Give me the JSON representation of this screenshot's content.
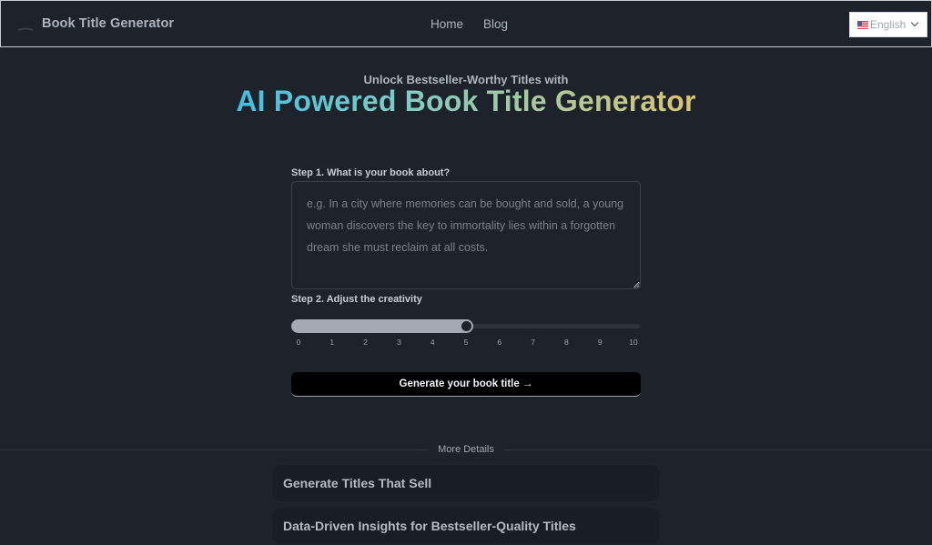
{
  "header": {
    "logo_icon": "open-book-icon",
    "brand": "Book Title Generator",
    "nav": [
      {
        "label": "Home"
      },
      {
        "label": "Blog"
      }
    ],
    "language": {
      "flag_icon": "us-flag-icon",
      "selected": "English",
      "chevron_icon": "chevron-down-icon"
    }
  },
  "hero": {
    "subtitle": "Unlock Bestseller-Worthy Titles with",
    "title": "AI Powered Book Title Generator",
    "gradient_colors": [
      "#45bde0",
      "#7ecbc5",
      "#a9c9a0",
      "#d9c473"
    ]
  },
  "form": {
    "step1_label": "Step 1. What is your book about?",
    "step1_value": "",
    "step1_placeholder": "e.g. In a city where memories can be bought and sold, a young woman discovers the key to immortality lies within a forgotten dream she must reclaim at all costs.",
    "step2_label": "Step 2. Adjust the creativity",
    "creativity": {
      "min": 0,
      "max": 10,
      "value": 5,
      "ticks": [
        "0",
        "1",
        "2",
        "3",
        "4",
        "5",
        "6",
        "7",
        "8",
        "9",
        "10"
      ]
    },
    "submit_label": "Generate your book title →"
  },
  "details": {
    "divider_label": "More Details",
    "cards": [
      {
        "title": "Generate Titles That Sell"
      },
      {
        "title": "Data-Driven Insights for Bestseller-Quality Titles"
      }
    ]
  }
}
